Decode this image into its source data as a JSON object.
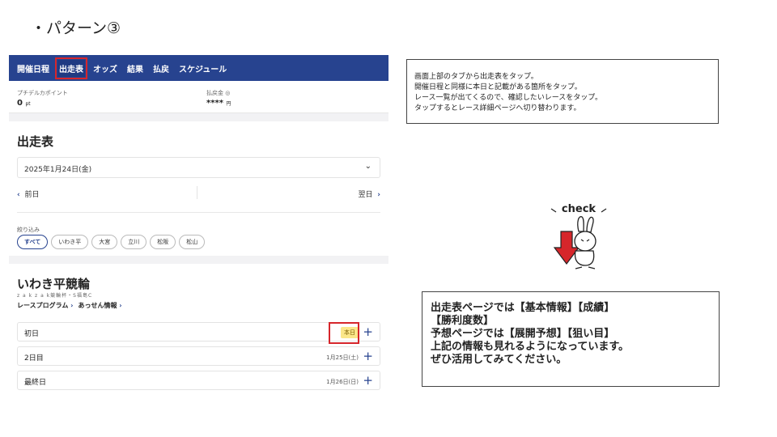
{
  "slide": {
    "heading": "・パターン③"
  },
  "app": {
    "tabs": [
      {
        "label": "開催日程",
        "active": false
      },
      {
        "label": "出走表",
        "active": true
      },
      {
        "label": "オッズ",
        "active": false
      },
      {
        "label": "結果",
        "active": false
      },
      {
        "label": "払戻",
        "active": false
      },
      {
        "label": "スケジュール",
        "active": false
      }
    ],
    "points": {
      "label": "プチデルカポイント",
      "value": "0",
      "unit": "pt"
    },
    "refund": {
      "label": "払戻金",
      "value": "****",
      "unit": "円"
    },
    "entry_table": {
      "title": "出走表",
      "date_value": "2025年1月24日(金)",
      "prev_label": "前日",
      "next_label": "翌日",
      "filter_label": "絞り込み",
      "filters": [
        "すべて",
        "いわき平",
        "大宮",
        "立川",
        "松阪",
        "松山"
      ]
    },
    "venue": {
      "name": "いわき平競輪",
      "subtitle": "z a k z a k競輪杯・S福島C",
      "links": [
        "レースプログラム",
        "あっせん情報"
      ],
      "days": [
        {
          "name": "初日",
          "date": "",
          "badge": "本日"
        },
        {
          "name": "2日目",
          "date": "1月25日(土)",
          "badge": ""
        },
        {
          "name": "最終日",
          "date": "1月26日(日)",
          "badge": ""
        }
      ]
    }
  },
  "callout_top": {
    "lines": [
      "画面上部のタブから出走表をタップ。",
      "開催日程と同様に本日と記載がある箇所をタップ。",
      "レース一覧が出てくるので、確認したいレースをタップ。",
      "タップするとレース詳細ページへ切り替わります。"
    ]
  },
  "check_badge": {
    "text": "check"
  },
  "callout_bottom": {
    "lines": [
      "出走表ページでは【基本情報】【成績】",
      "【勝利度数】",
      "予想ページでは【展開予想】【狙い目】",
      "上記の情報も見れるようになっています。",
      "ぜひ活用してみてください。"
    ]
  },
  "colors": {
    "nav": "#27438f",
    "highlight": "#d6262b",
    "badge": "#fbe78a"
  }
}
